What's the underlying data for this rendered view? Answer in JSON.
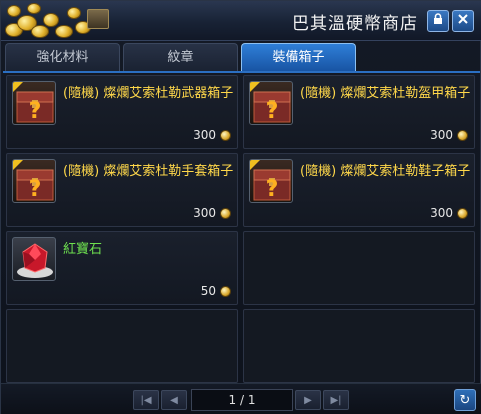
{
  "window": {
    "title": "巴其溫硬幣商店",
    "lock_icon": "lock-icon",
    "close_icon": "close-icon"
  },
  "tabs": [
    {
      "label": "強化材料",
      "active": false
    },
    {
      "label": "紋章",
      "active": false
    },
    {
      "label": "裝備箱子",
      "active": true
    }
  ],
  "items": [
    {
      "name": "(隨機) 燦爛艾索杜勒武器箱子",
      "price": "300",
      "icon": "mystery-chest-icon",
      "name_color": "#ffd84a"
    },
    {
      "name": "(隨機) 燦爛艾索杜勒盔甲箱子",
      "price": "300",
      "icon": "mystery-chest-icon",
      "name_color": "#ffd84a"
    },
    {
      "name": "(隨機) 燦爛艾索杜勒手套箱子",
      "price": "300",
      "icon": "mystery-chest-icon",
      "name_color": "#ffd84a"
    },
    {
      "name": "(隨機) 燦爛艾索杜勒鞋子箱子",
      "price": "300",
      "icon": "mystery-chest-icon",
      "name_color": "#ffd84a"
    },
    {
      "name": "紅寶石",
      "price": "50",
      "icon": "ruby-gem-icon",
      "name_color": "#6ee04f"
    }
  ],
  "pager": {
    "page": "1 / 1"
  },
  "colors": {
    "accent": "#2f7fd8",
    "item_name": "#ffd84a",
    "gem_name": "#6ee04f"
  }
}
